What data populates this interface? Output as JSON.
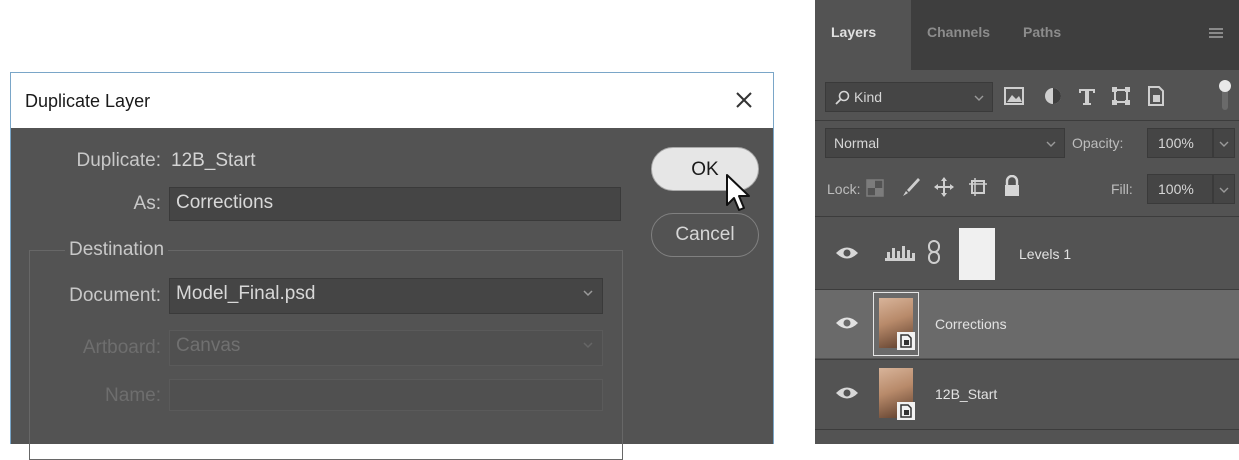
{
  "dialog": {
    "title": "Duplicate Layer",
    "duplicate_label": "Duplicate:",
    "duplicate_value": "12B_Start",
    "as_label": "As:",
    "as_value": "Corrections",
    "destination_label": "Destination",
    "document_label": "Document:",
    "document_value": "Model_Final.psd",
    "artboard_label": "Artboard:",
    "artboard_value": "Canvas",
    "name_label": "Name:",
    "name_value": "",
    "ok_label": "OK",
    "cancel_label": "Cancel"
  },
  "layers_panel": {
    "tabs": [
      "Layers",
      "Channels",
      "Paths"
    ],
    "filter_kind": "Kind",
    "blend_mode": "Normal",
    "opacity_label": "Opacity:",
    "opacity_value": "100%",
    "lock_label": "Lock:",
    "fill_label": "Fill:",
    "fill_value": "100%",
    "layers": [
      {
        "name": "Levels 1",
        "type": "adjustment",
        "selected": false
      },
      {
        "name": "Corrections",
        "type": "smart-object",
        "selected": true
      },
      {
        "name": "12B_Start",
        "type": "smart-object",
        "selected": false
      }
    ]
  },
  "colors": {
    "dialog_bg": "#535353",
    "panel_bg": "#535353",
    "selected_layer": "#6a6a6a",
    "dialog_border": "#7aa6c8"
  }
}
